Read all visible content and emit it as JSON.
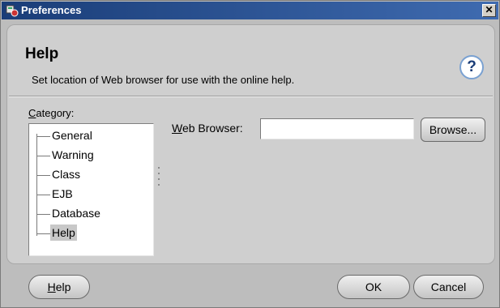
{
  "window": {
    "title": "Preferences",
    "close_glyph": "✕",
    "icon": "app-icon"
  },
  "header": {
    "title": "Help",
    "description": "Set location of Web browser for use with the online help.",
    "help_badge": "?"
  },
  "category": {
    "label_mnemonic": "C",
    "label_rest": "ategory:",
    "items": [
      {
        "label": "General",
        "selected": false
      },
      {
        "label": "Warning",
        "selected": false
      },
      {
        "label": "Class",
        "selected": false
      },
      {
        "label": "EJB",
        "selected": false
      },
      {
        "label": "Database",
        "selected": false
      },
      {
        "label": "Help",
        "selected": true
      }
    ]
  },
  "settings": {
    "web_browser_label_mnemonic": "W",
    "web_browser_label_rest": "eb Browser:",
    "web_browser_value": "",
    "browse_button": "Browse..."
  },
  "footer": {
    "help_mnemonic": "H",
    "help_rest": "elp",
    "ok": "OK",
    "cancel": "Cancel"
  },
  "colors": {
    "titlebar": "#1a3d78",
    "dialog_bg": "#bdbdbd",
    "panel_bg": "#cfcfcf"
  }
}
